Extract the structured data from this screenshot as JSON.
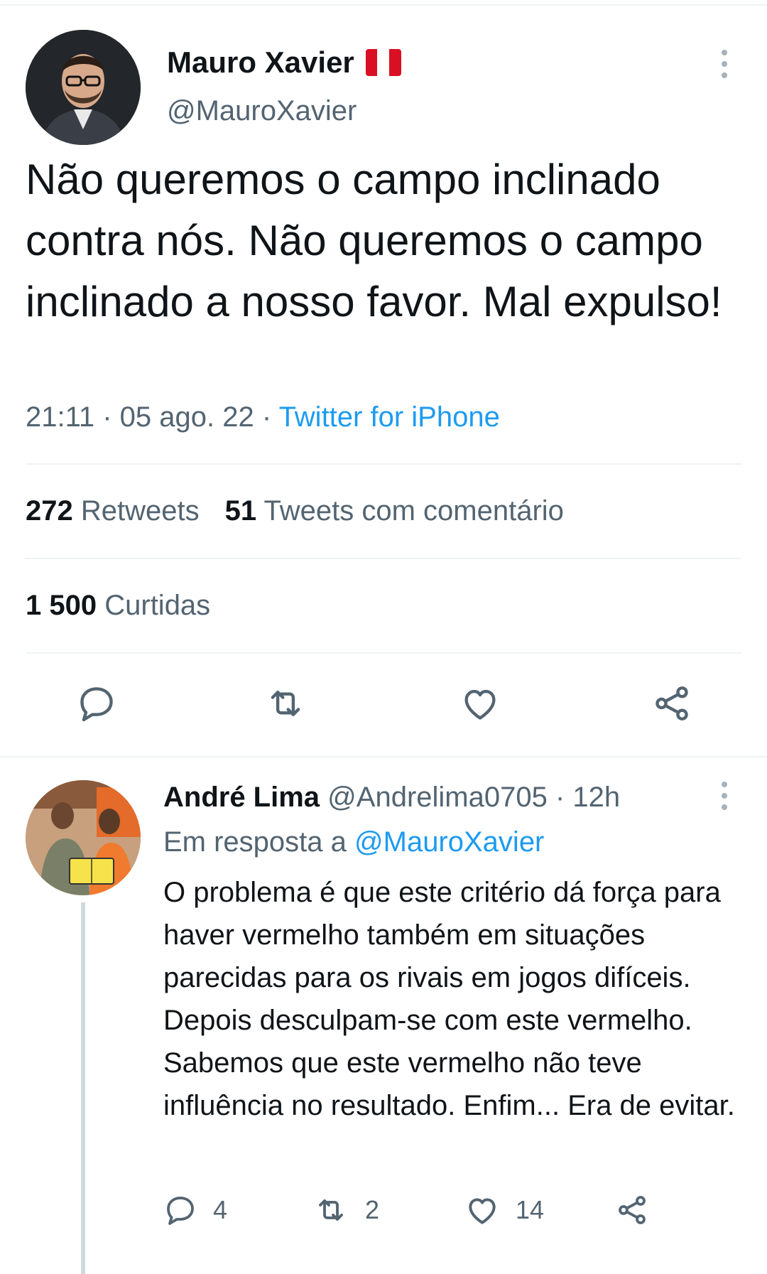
{
  "tweet": {
    "author_name": "Mauro Xavier",
    "author_handle": "@MauroXavier",
    "flag_colors": [
      "#d91023",
      "#ffffff",
      "#d91023"
    ],
    "text": "Não queremos o campo inclinado contra nós. Não queremos o campo inclinado a nosso favor. Mal expulso!",
    "time_date": "21:11 · 05 ago. 22 · ",
    "source": "Twitter for iPhone",
    "retweets_count": "272",
    "retweets_label": "Retweets",
    "quotes_count": "51",
    "quotes_label": "Tweets com comentário",
    "likes_count": "1 500",
    "likes_label": "Curtidas",
    "actions": [
      "reply-icon",
      "retweet-icon",
      "like-icon",
      "share-icon"
    ]
  },
  "reply": {
    "author_name": "André Lima",
    "author_handle": "@Andrelima0705",
    "time_ago": "· 12h",
    "reply_to_label": "Em resposta a",
    "reply_to_mention": "@MauroXavier",
    "text": "O problema é que este critério dá  força para haver vermelho também em situações parecidas para os rivais em jogos difíceis. Depois desculpam-se com este vermelho.  Sabemos que este vermelho não teve influência no resultado. Enfim... Era de evitar.",
    "reply_count": "4",
    "retweet_count": "2",
    "like_count": "14"
  },
  "colors": {
    "accent": "#1d9bf0",
    "secondary_text": "#536471",
    "icon": "#536471",
    "divider": "#eff3f4"
  }
}
